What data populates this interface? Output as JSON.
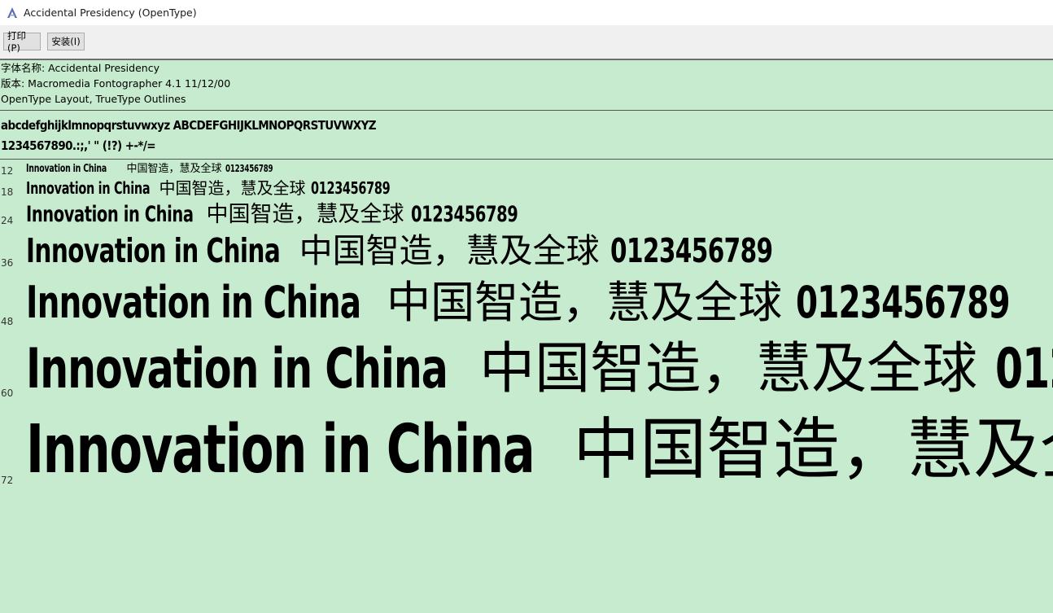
{
  "window": {
    "title": "Accidental Presidency (OpenType)",
    "icon": "font-viewer-icon"
  },
  "toolbar": {
    "print_label": "打印(P)",
    "install_label": "安装(I)"
  },
  "info": {
    "font_name": "字体名称: Accidental Presidency",
    "version": "版本: Macromedia Fontographer 4.1 11/12/00",
    "outline": "OpenType Layout, TrueType Outlines"
  },
  "charset": {
    "line1": "abcdefghijklmnopqrstuvwxyz ABCDEFGHIJKLMNOPQRSTUVWXYZ",
    "line2": "1234567890.:;,' \" (!?) +-*/="
  },
  "samples": {
    "latin": "Innovation in China",
    "cjk": "中国智造，慧及全球",
    "digits": "0123456789",
    "sizes": [
      "12",
      "18",
      "24",
      "36",
      "48",
      "60",
      "72"
    ]
  }
}
